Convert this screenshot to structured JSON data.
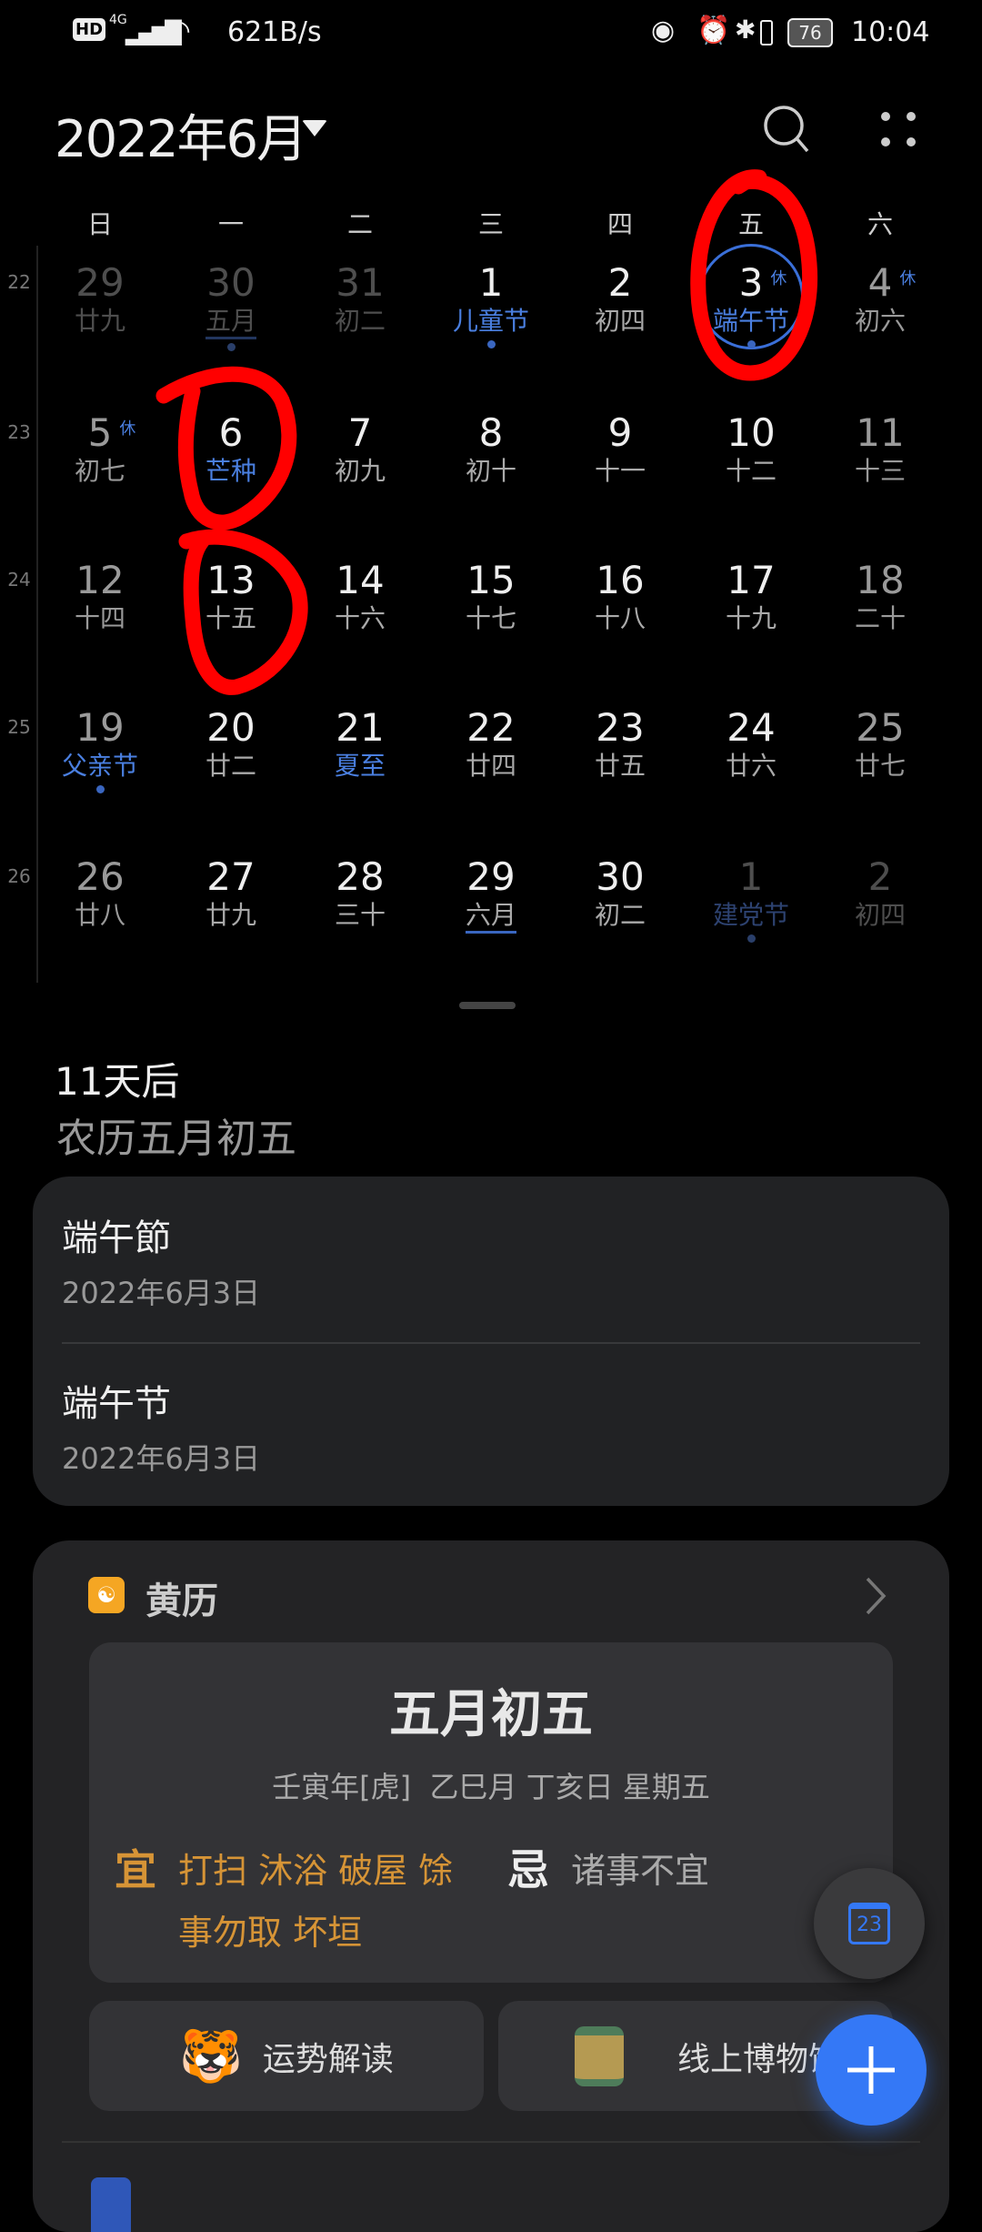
{
  "status_bar": {
    "network_speed": "621B/s",
    "network_type": "4G",
    "hd": "HD",
    "battery": "76",
    "time": "10:04"
  },
  "header": {
    "title": "2022年6月",
    "search_icon": "search-icon",
    "more_icon": "more-dots-icon"
  },
  "weekdays": [
    "日",
    "一",
    "二",
    "三",
    "四",
    "五",
    "六"
  ],
  "week_numbers": [
    "22",
    "23",
    "24",
    "25",
    "26"
  ],
  "weeks": [
    [
      {
        "d": "29",
        "l": "廿九",
        "o": 1
      },
      {
        "d": "30",
        "l": "五月",
        "o": 1,
        "u": 1,
        "dot": 1
      },
      {
        "d": "31",
        "l": "初二",
        "o": 1
      },
      {
        "d": "1",
        "l": "儿童节",
        "h": 1,
        "dot": 1
      },
      {
        "d": "2",
        "l": "初四"
      },
      {
        "d": "3",
        "l": "端午节",
        "h": 1,
        "r": "休",
        "dot": 1,
        "sel": 1
      },
      {
        "d": "4",
        "l": "初六",
        "r": "休"
      }
    ],
    [
      {
        "d": "5",
        "l": "初七",
        "r": "休"
      },
      {
        "d": "6",
        "l": "芒种",
        "h": 1
      },
      {
        "d": "7",
        "l": "初九"
      },
      {
        "d": "8",
        "l": "初十"
      },
      {
        "d": "9",
        "l": "十一"
      },
      {
        "d": "10",
        "l": "十二"
      },
      {
        "d": "11",
        "l": "十三"
      }
    ],
    [
      {
        "d": "12",
        "l": "十四"
      },
      {
        "d": "13",
        "l": "十五"
      },
      {
        "d": "14",
        "l": "十六"
      },
      {
        "d": "15",
        "l": "十七"
      },
      {
        "d": "16",
        "l": "十八"
      },
      {
        "d": "17",
        "l": "十九"
      },
      {
        "d": "18",
        "l": "二十"
      }
    ],
    [
      {
        "d": "19",
        "l": "父亲节",
        "h": 1,
        "dot": 1
      },
      {
        "d": "20",
        "l": "廿二"
      },
      {
        "d": "21",
        "l": "夏至",
        "h": 1
      },
      {
        "d": "22",
        "l": "廿四"
      },
      {
        "d": "23",
        "l": "廿五"
      },
      {
        "d": "24",
        "l": "廿六"
      },
      {
        "d": "25",
        "l": "廿七"
      }
    ],
    [
      {
        "d": "26",
        "l": "廿八"
      },
      {
        "d": "27",
        "l": "廿九"
      },
      {
        "d": "28",
        "l": "三十"
      },
      {
        "d": "29",
        "l": "六月",
        "u": 1
      },
      {
        "d": "30",
        "l": "初二"
      },
      {
        "d": "1",
        "l": "建党节",
        "o": 1,
        "h": 1,
        "dot": 1
      },
      {
        "d": "2",
        "l": "初四",
        "o": 1
      }
    ]
  ],
  "countdown": {
    "days": "11天后",
    "lunar": "农历五月初五"
  },
  "events": [
    {
      "title": "端午節",
      "date": "2022年6月3日"
    },
    {
      "title": "端午节",
      "date": "2022年6月3日"
    }
  ],
  "huangli": {
    "title": "黄历",
    "lunar_date": "五月初五",
    "ganzhi": "壬寅年[虎]  乙巳月 丁亥日 星期五",
    "yi_label": "宜",
    "yi_line1": "打扫 沐浴 破屋 馀",
    "yi_line2": "事勿取 坏垣",
    "ji_label": "忌",
    "ji_text": "诸事不宜",
    "buttons": [
      {
        "label": "运势解读",
        "icon": "tiger-icon"
      },
      {
        "label": "线上博物馆",
        "icon": "bronze-mask-icon"
      }
    ]
  },
  "fab": {
    "today_day": "23",
    "add_icon": "plus-icon"
  },
  "colors": {
    "accent": "#3478f6",
    "holiday": "#4a7fe0",
    "yi": "#d69436",
    "annotation": "#ff0000"
  }
}
